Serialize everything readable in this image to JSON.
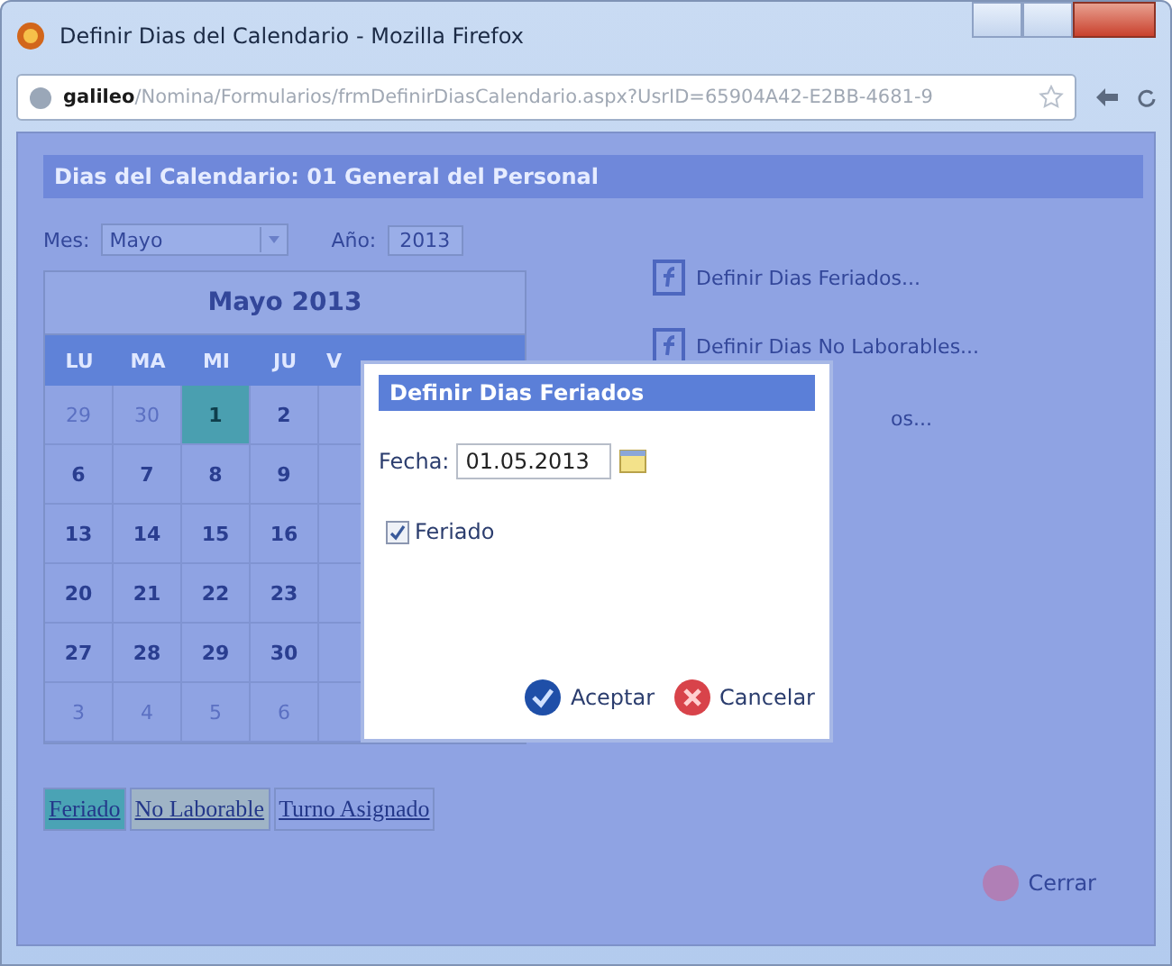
{
  "window": {
    "title": "Definir Dias del Calendario - Mozilla Firefox"
  },
  "address_bar": {
    "url": "**galileo**/Nomina/Formularios/frmDefinirDiasCalendario.aspx?UsrID=65904A42-E2BB-4681-9"
  },
  "page": {
    "header": "Dias del Calendario: 01 General del Personal",
    "month_label": "Mes:",
    "month_value": "Mayo",
    "year_label": "Año:",
    "year_value": "2013"
  },
  "calendar": {
    "title": "Mayo  2013",
    "weekdays": [
      "LU",
      "MA",
      "MI",
      "JU",
      "V"
    ],
    "weeks": [
      [
        {
          "day": "29",
          "other_month": true,
          "selected": false
        },
        {
          "day": "30",
          "other_month": true,
          "selected": false
        },
        {
          "day": "1",
          "other_month": false,
          "selected": true
        },
        {
          "day": "2",
          "other_month": false,
          "selected": false
        }
      ],
      [
        {
          "day": "6",
          "other_month": false,
          "selected": false
        },
        {
          "day": "7",
          "other_month": false,
          "selected": false
        },
        {
          "day": "8",
          "other_month": false,
          "selected": false
        },
        {
          "day": "9",
          "other_month": false,
          "selected": false
        }
      ],
      [
        {
          "day": "13",
          "other_month": false,
          "selected": false
        },
        {
          "day": "14",
          "other_month": false,
          "selected": false
        },
        {
          "day": "15",
          "other_month": false,
          "selected": false
        },
        {
          "day": "16",
          "other_month": false,
          "selected": false
        }
      ],
      [
        {
          "day": "20",
          "other_month": false,
          "selected": false
        },
        {
          "day": "21",
          "other_month": false,
          "selected": false
        },
        {
          "day": "22",
          "other_month": false,
          "selected": false
        },
        {
          "day": "23",
          "other_month": false,
          "selected": false
        }
      ],
      [
        {
          "day": "27",
          "other_month": false,
          "selected": false
        },
        {
          "day": "28",
          "other_month": false,
          "selected": false
        },
        {
          "day": "29",
          "other_month": false,
          "selected": false
        },
        {
          "day": "30",
          "other_month": false,
          "selected": false
        }
      ],
      [
        {
          "day": "3",
          "other_month": true,
          "selected": false
        },
        {
          "day": "4",
          "other_month": true,
          "selected": false
        },
        {
          "day": "5",
          "other_month": true,
          "selected": false
        },
        {
          "day": "6",
          "other_month": true,
          "selected": false
        }
      ]
    ]
  },
  "actions": [
    {
      "label": "Definir Dias Feriados..."
    },
    {
      "label": "Definir Dias No Laborables..."
    },
    {
      "label": "os..."
    }
  ],
  "legend": [
    {
      "label": "Feriado",
      "color": "#4aa3b5"
    },
    {
      "label": "No Laborable",
      "color": "#9fb4c6"
    },
    {
      "label": "Turno Asignado",
      "color": "#8fa3e3"
    }
  ],
  "close_button": {
    "label": "Cerrar"
  },
  "dialog": {
    "title": "Definir Dias Feriados",
    "date_label": "Fecha:",
    "date_value": "01.05.2013",
    "checkbox": {
      "label": "Feriado",
      "checked": true
    },
    "buttons": [
      {
        "label": "Aceptar",
        "kind": "accept"
      },
      {
        "label": "Cancelar",
        "kind": "cancel"
      }
    ]
  }
}
